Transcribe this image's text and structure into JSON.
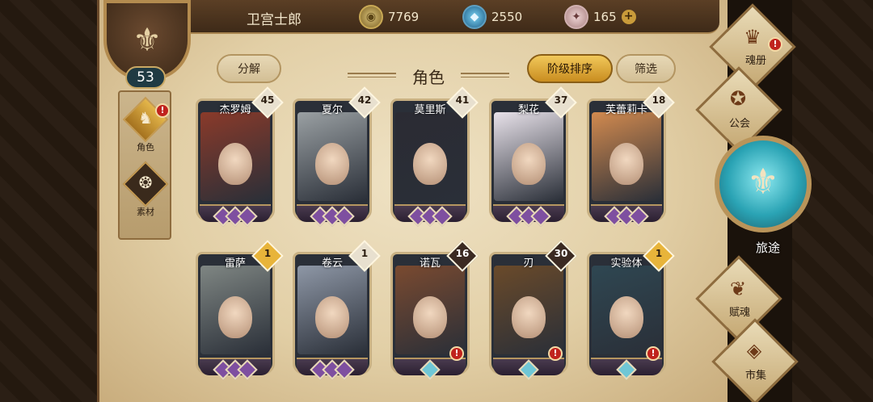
{
  "player": {
    "name": "卫宫士郎",
    "level": "53"
  },
  "resources": [
    {
      "icon": "gold-coin-icon",
      "value": "7769"
    },
    {
      "icon": "blue-crystal-icon",
      "value": "2550"
    },
    {
      "icon": "pink-gem-icon",
      "value": "165"
    }
  ],
  "side_tabs": [
    {
      "label": "角色",
      "icon": "character-icon",
      "active": true,
      "alert": true
    },
    {
      "label": "素材",
      "icon": "material-icon",
      "active": false,
      "alert": false
    }
  ],
  "header": {
    "decompose_label": "分解",
    "title": "角色",
    "sort_label": "阶级排序",
    "filter_label": "筛选"
  },
  "characters": [
    {
      "name": "杰罗姆",
      "level": "45",
      "badge_color": "#e8e0cf",
      "tint": "#8a3a2a",
      "gem_color": "#7e4fa0",
      "alert": false
    },
    {
      "name": "夏尔",
      "level": "42",
      "badge_color": "#e8e0cf",
      "tint": "#9aa0a3",
      "gem_color": "#7e4fa0",
      "alert": false
    },
    {
      "name": "莫里斯",
      "level": "41",
      "badge_color": "#e8e0cf",
      "tint": "#2b2b33",
      "gem_color": "#7e4fa0",
      "alert": false
    },
    {
      "name": "梨花",
      "level": "37",
      "badge_color": "#e8e0cf",
      "tint": "#e8e2ea",
      "gem_color": "#7e4fa0",
      "alert": false
    },
    {
      "name": "芙蕾莉卡",
      "level": "18",
      "badge_color": "#e8e0cf",
      "tint": "#d28a4f",
      "gem_color": "#7e4fa0",
      "alert": false
    },
    {
      "name": "雷萨",
      "level": "1",
      "badge_color": "#e8b43a",
      "tint": "#7f8683",
      "gem_color": "#7e4fa0",
      "alert": false
    },
    {
      "name": "卷云",
      "level": "1",
      "badge_color": "#e8e0cf",
      "tint": "#8e97a6",
      "gem_color": "#7e4fa0",
      "alert": false
    },
    {
      "name": "诺瓦",
      "level": "16",
      "badge_color": "#3b2a22",
      "tint": "#7a4a30",
      "gem_color": "#6fc7d6",
      "alert": true
    },
    {
      "name": "刃",
      "level": "30",
      "badge_color": "#3b2a22",
      "tint": "#6a4a2a",
      "gem_color": "#6fc7d6",
      "alert": true
    },
    {
      "name": "实验体",
      "level": "1",
      "badge_color": "#e8b43a",
      "tint": "#2f4752",
      "gem_color": "#6fc7d6",
      "alert": true
    }
  ],
  "right_menu": [
    {
      "label": "魂册",
      "icon": "soul-book-icon",
      "alert": true
    },
    {
      "label": "公会",
      "icon": "guild-icon",
      "alert": false
    },
    {
      "label": "旅途",
      "icon": "journey-icon",
      "alert": false
    },
    {
      "label": "赋魂",
      "icon": "empower-icon",
      "alert": false
    },
    {
      "label": "市集",
      "icon": "market-icon",
      "alert": false
    }
  ],
  "colors": {
    "accent_gold": "#e8b43a",
    "alert_red": "#c0231d",
    "journey_teal": "#2aa3b4"
  }
}
